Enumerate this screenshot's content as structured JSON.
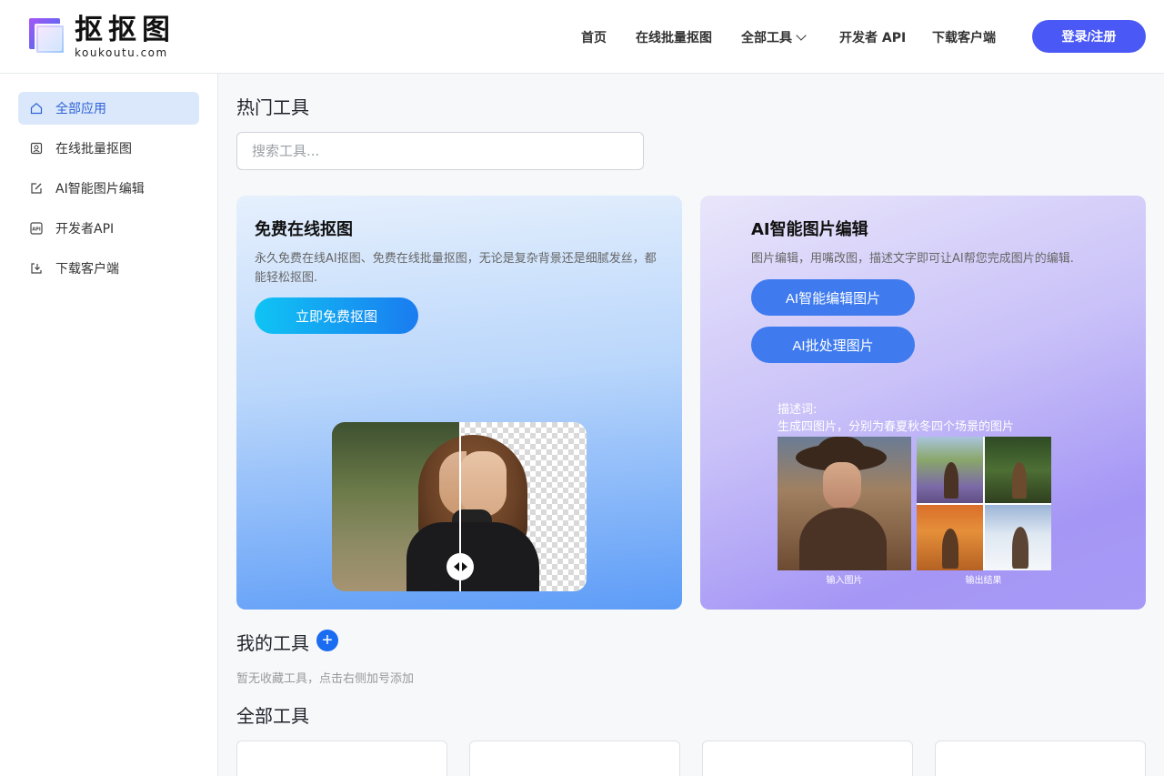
{
  "header": {
    "logo_cn": "抠抠图",
    "logo_en": "koukoutu.com",
    "nav": [
      {
        "label": "首页"
      },
      {
        "label": "在线批量抠图"
      },
      {
        "label": "全部工具"
      },
      {
        "label": "开发者 API"
      },
      {
        "label": "下载客户端"
      }
    ],
    "login_label": "登录/注册"
  },
  "sidebar": {
    "items": [
      {
        "label": "全部应用",
        "icon": "home-icon",
        "active": true
      },
      {
        "label": "在线批量抠图",
        "icon": "portrait-icon",
        "active": false
      },
      {
        "label": "AI智能图片编辑",
        "icon": "edit-icon",
        "active": false
      },
      {
        "label": "开发者API",
        "icon": "api-icon",
        "active": false
      },
      {
        "label": "下载客户端",
        "icon": "download-icon",
        "active": false
      }
    ]
  },
  "main": {
    "hot_tools_title": "热门工具",
    "search_placeholder": "搜索工具...",
    "card_cutout": {
      "title": "免费在线抠图",
      "desc": "永久免费在线AI抠图、免费在线批量抠图，无论是复杂背景还是细腻发丝，都能轻松抠图.",
      "cta": "立即免费抠图"
    },
    "card_ai_edit": {
      "title": "AI智能图片编辑",
      "desc": "图片编辑，用嘴改图，描述文字即可让AI帮您完成图片的编辑.",
      "cta_edit": "AI智能编辑图片",
      "cta_batch": "AI批处理图片",
      "prompt_label": "描述词:",
      "prompt_text": "生成四图片，分别为春夏秋冬四个场景的图片",
      "input_caption": "输入图片",
      "output_caption": "输出结果"
    },
    "my_tools_title": "我的工具",
    "my_tools_empty": "暂无收藏工具，点击右侧加号添加",
    "all_tools_title": "全部工具"
  },
  "colors": {
    "primary": "#4a59f5",
    "accent_blue": "#1a6cf0",
    "sidebar_active_bg": "#dbe8fb"
  }
}
